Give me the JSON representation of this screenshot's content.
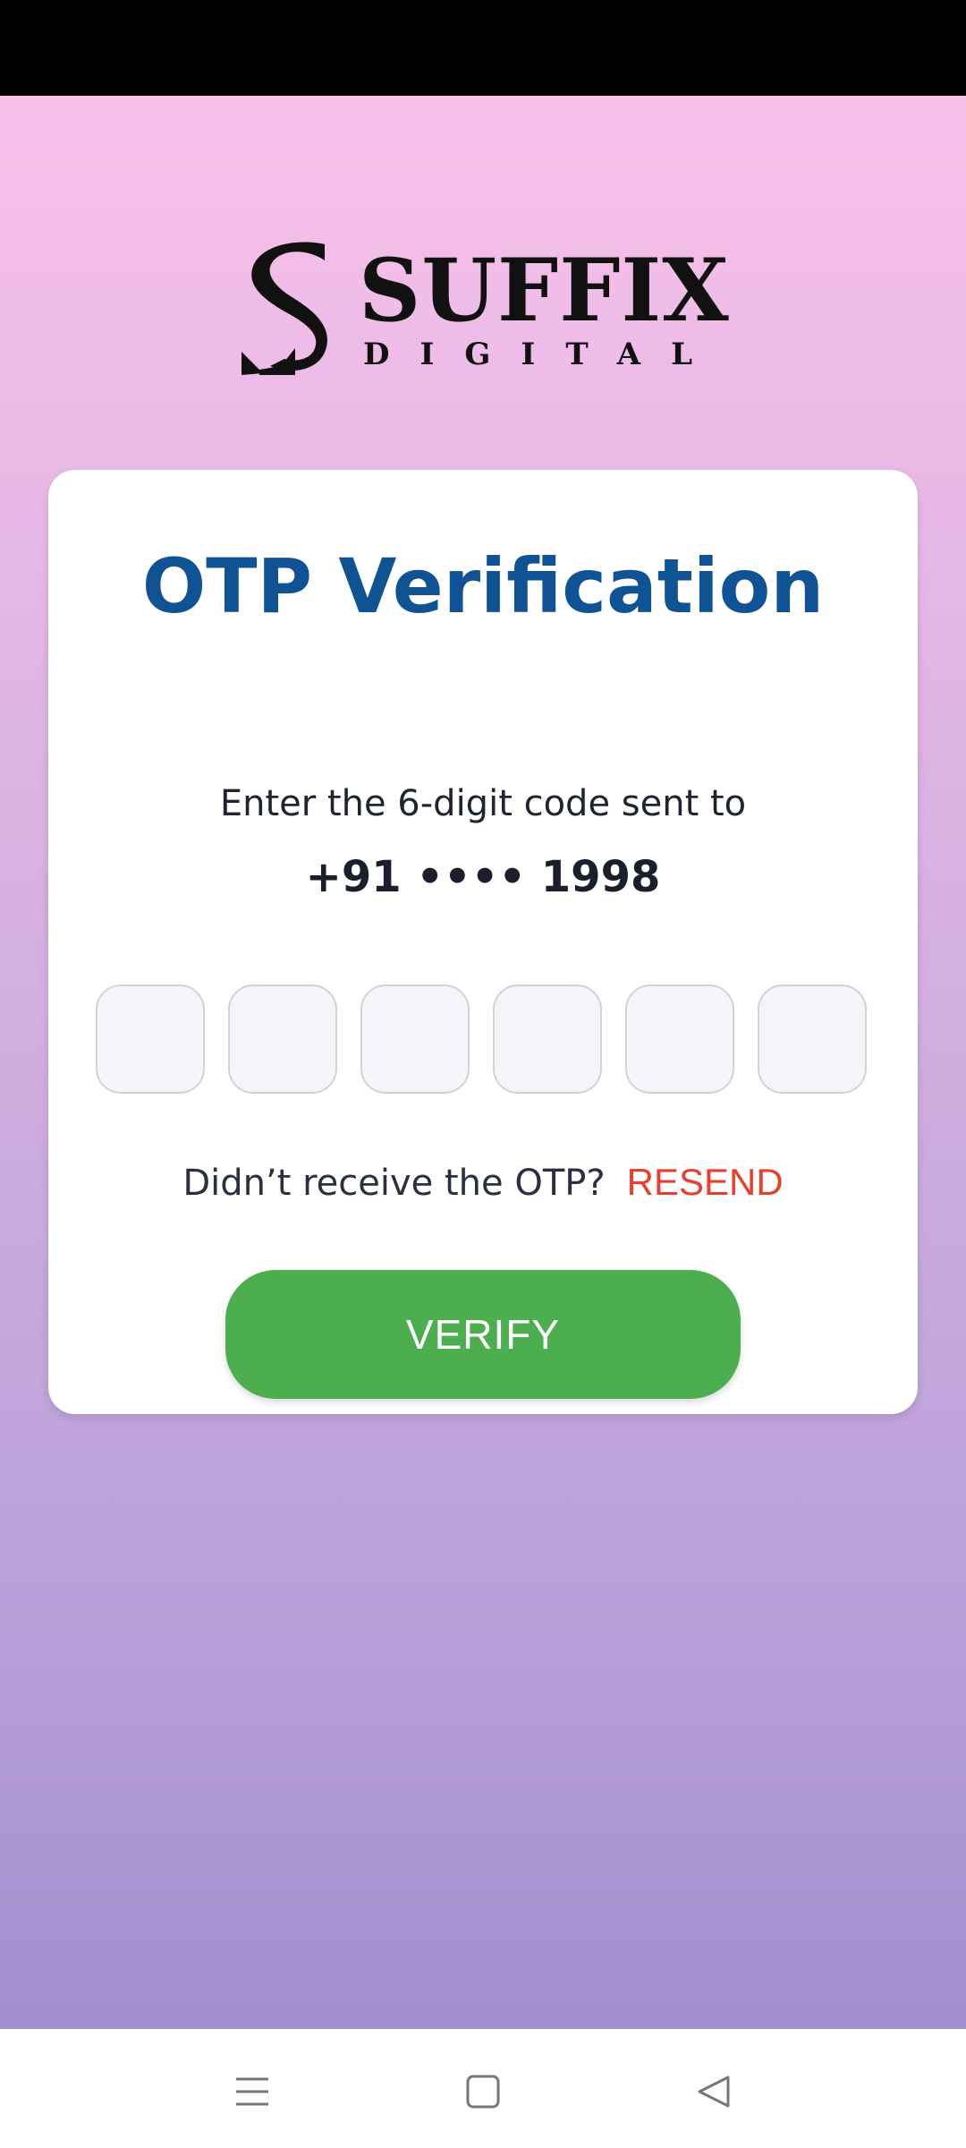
{
  "logo": {
    "wordmark": "SUFFIX",
    "submark": "DIGITAL"
  },
  "card": {
    "title": "OTP Verification",
    "instruction": "Enter the 6-digit code sent to",
    "phone": "+91 •••• 1998",
    "otp_digits": [
      "",
      "",
      "",
      "",
      "",
      ""
    ],
    "resend_prompt": "Didn’t receive the OTP?",
    "resend_label": "RESEND",
    "verify_label": "VERIFY"
  },
  "colors": {
    "title": "#105394",
    "resend": "#e8402f",
    "verify_button": "#4cae4f",
    "gradient_top": "#f8c1ea",
    "gradient_bottom": "#a28ecf"
  },
  "nav": {
    "icons": [
      "menu-icon",
      "home-icon",
      "back-icon"
    ]
  }
}
